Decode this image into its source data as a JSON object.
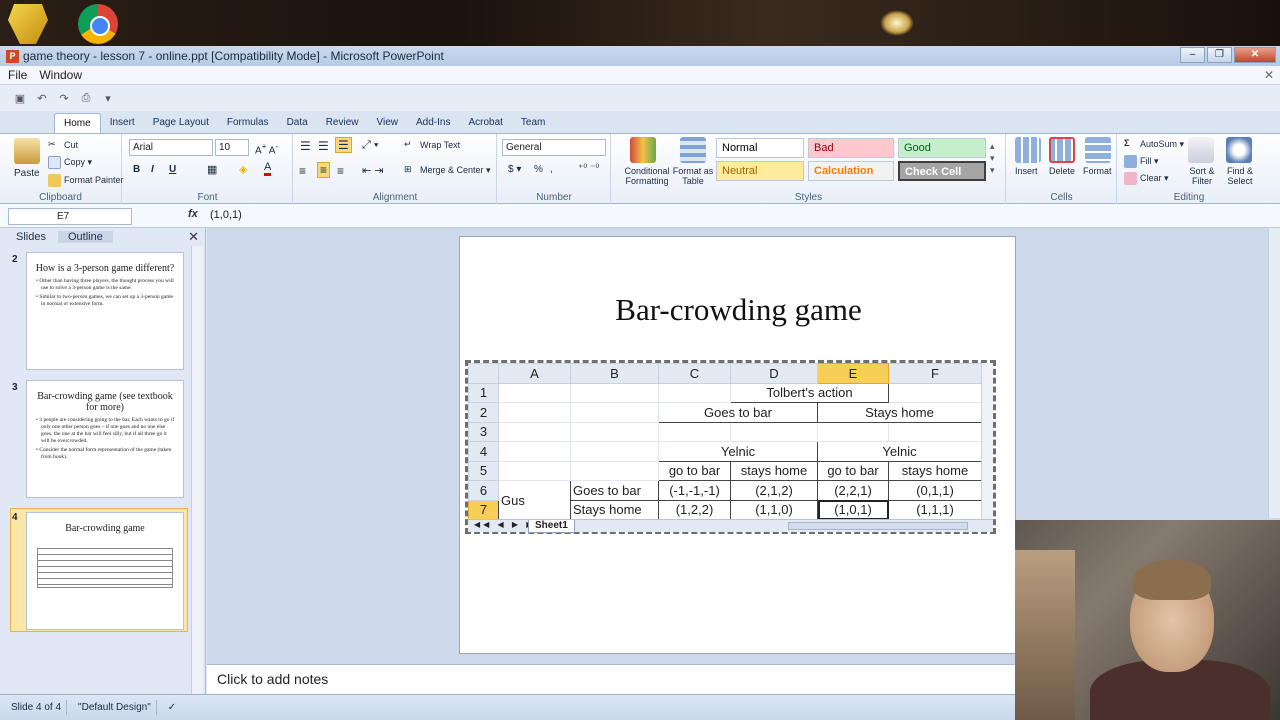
{
  "window": {
    "title": "game theory - lesson 7 - online.ppt [Compatibility Mode] - Microsoft PowerPoint",
    "app_icon_letter": "P"
  },
  "menu": [
    "File",
    "Window"
  ],
  "tabs": [
    "Home",
    "Insert",
    "Page Layout",
    "Formulas",
    "Data",
    "Review",
    "View",
    "Add-Ins",
    "Acrobat",
    "Team"
  ],
  "ribbon": {
    "clipboard": {
      "paste": "Paste",
      "cut": "Cut",
      "copy": "Copy",
      "format_painter": "Format Painter",
      "label": "Clipboard"
    },
    "font": {
      "name": "Arial",
      "size": "10",
      "label": "Font"
    },
    "alignment": {
      "wrap_text": "Wrap Text",
      "merge_center": "Merge & Center",
      "label": "Alignment"
    },
    "number": {
      "format": "General",
      "label": "Number"
    },
    "styles": {
      "conditional": "Conditional Formatting",
      "format_table": "Format as Table",
      "cells": [
        {
          "text": "Normal",
          "bg": "#ffffff",
          "color": "#000000"
        },
        {
          "text": "Bad",
          "bg": "#ffc7ce",
          "color": "#9c0006"
        },
        {
          "text": "Good",
          "bg": "#c6efce",
          "color": "#006100"
        },
        {
          "text": "Neutral",
          "bg": "#ffeb9c",
          "color": "#9c6500"
        },
        {
          "text": "Calculation",
          "bg": "#f2f2f2",
          "color": "#fa7d00"
        },
        {
          "text": "Check Cell",
          "bg": "#a5a5a5",
          "color": "#ffffff"
        }
      ],
      "label": "Styles"
    },
    "cells": {
      "insert": "Insert",
      "delete": "Delete",
      "format": "Format",
      "label": "Cells"
    },
    "editing": {
      "autosum": "AutoSum",
      "fill": "Fill",
      "clear": "Clear",
      "sort": "Sort & Filter",
      "find": "Find & Select",
      "label": "Editing"
    }
  },
  "formula_bar": {
    "name_box": "E7",
    "fx": "fx",
    "formula": "(1,0,1)"
  },
  "slides_panel": {
    "tabs": [
      "Slides",
      "Outline"
    ],
    "slides": [
      {
        "num": "2",
        "title": "How is a 3-person game different?",
        "bullets": [
          "Other than having three players, the thought process you will use to solve a 3-person game is the same.",
          "Similar to two-person games, we can set up a 3-person game in normal or extensive form."
        ]
      },
      {
        "num": "3",
        "title": "Bar-crowding game (see textbook for more)",
        "bullets": [
          "3 people are considering going to the bar. Each wants to go if only one other person goes – if one goes and no one else goes, the one at the bar will feel silly, but if all three go it will be overcrowded.",
          "Consider the normal form representation of the game (taken from book)."
        ]
      },
      {
        "num": "4",
        "title": "Bar-crowding game"
      }
    ]
  },
  "slide": {
    "title": "Bar-crowding game",
    "sheet": {
      "col_headers": [
        "A",
        "B",
        "C",
        "D",
        "E",
        "F"
      ],
      "row_headers": [
        "1",
        "2",
        "3",
        "4",
        "5",
        "6",
        "7"
      ],
      "tolbert": "Tolbert's action",
      "goes_to_bar": "Goes to bar",
      "stays_home": "Stays home",
      "yelnic": "Yelnic",
      "go_to_bar": "go to bar",
      "stays_home_lc": "stays home",
      "gus": "Gus",
      "row6": {
        "label": "Goes to bar",
        "c": "(-1,-1,-1)",
        "d": "(2,1,2)",
        "e": "(2,2,1)",
        "f": "(0,1,1)"
      },
      "row7": {
        "label": "Stays home",
        "c": "(1,2,2)",
        "d": "(1,1,0)",
        "e": "(1,0,1)",
        "f": "(1,1,1)"
      },
      "tab": "Sheet1"
    }
  },
  "notes": "Click to add notes",
  "status": {
    "slide": "Slide 4 of 4",
    "theme": "\"Default Design\""
  }
}
